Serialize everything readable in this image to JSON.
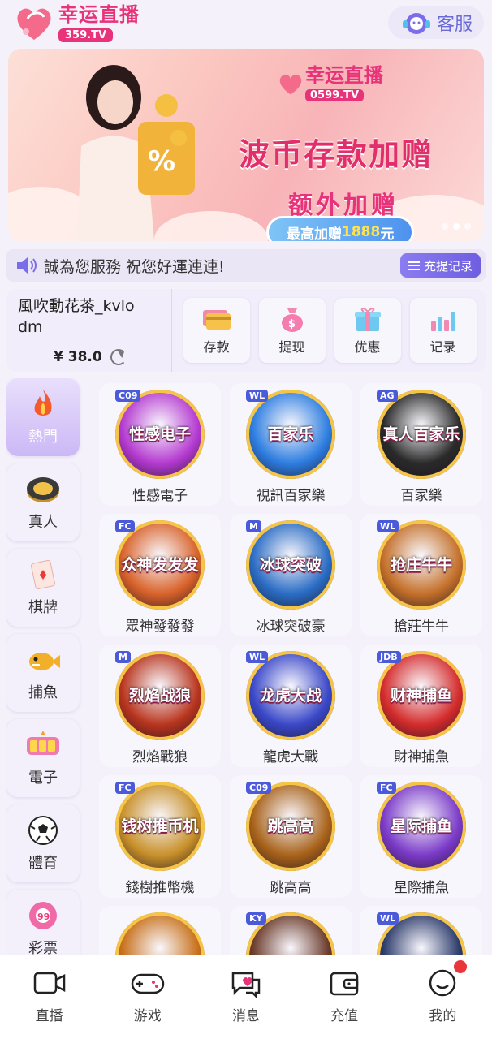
{
  "header": {
    "logo_title": "幸运直播",
    "logo_badge": "359.TV",
    "service_label": "客服"
  },
  "banner": {
    "brand_title": "幸运直播",
    "brand_badge": "0599.TV",
    "headline": "波币存款加赠",
    "subline": "额外加赠",
    "pill_prefix": "最高加赠",
    "pill_amount": "1888",
    "pill_suffix": "元",
    "slide_count": 3,
    "active_slide": 1
  },
  "notice": {
    "text": "誠為您服務 祝您好運連連!",
    "button_label": "充提记录"
  },
  "user": {
    "name": "風吹動花茶_kvlodm",
    "balance": "¥ 38.0"
  },
  "actions": [
    {
      "label": "存款",
      "icon": "card-icon"
    },
    {
      "label": "提现",
      "icon": "money-bag-icon"
    },
    {
      "label": "优惠",
      "icon": "gift-icon"
    },
    {
      "label": "记录",
      "icon": "bar-chart-icon"
    }
  ],
  "categories": [
    {
      "label": "熱門",
      "icon": "flame-icon",
      "active": true
    },
    {
      "label": "真人",
      "icon": "chip-icon",
      "active": false
    },
    {
      "label": "棋牌",
      "icon": "card-icon",
      "active": false
    },
    {
      "label": "捕魚",
      "icon": "fish-icon",
      "active": false
    },
    {
      "label": "電子",
      "icon": "slot-icon",
      "active": false
    },
    {
      "label": "體育",
      "icon": "soccer-ball-icon",
      "active": false
    },
    {
      "label": "彩票",
      "icon": "lottery-ball-icon",
      "active": false
    }
  ],
  "games": [
    {
      "name": "性感電子",
      "thumb_text": "性感电子",
      "provider": "C09",
      "color": "#b43ad0"
    },
    {
      "name": "視訊百家樂",
      "thumb_text": "百家乐",
      "provider": "WL",
      "color": "#2d7de0"
    },
    {
      "name": "百家樂",
      "thumb_text": "真人百家乐",
      "provider": "AG",
      "color": "#2a2a2a"
    },
    {
      "name": "眾神發發發",
      "thumb_text": "众神发发发",
      "provider": "FC",
      "color": "#d8622a"
    },
    {
      "name": "冰球突破豪",
      "thumb_text": "冰球突破",
      "provider": "M",
      "color": "#2a6cc4"
    },
    {
      "name": "搶莊牛牛",
      "thumb_text": "抢庄牛牛",
      "provider": "WL",
      "color": "#c4702a"
    },
    {
      "name": "烈焰戰狼",
      "thumb_text": "烈焰战狼",
      "provider": "M",
      "color": "#b8351e"
    },
    {
      "name": "龍虎大戰",
      "thumb_text": "龙虎大战",
      "provider": "WL",
      "color": "#3a48c8"
    },
    {
      "name": "財神捕魚",
      "thumb_text": "财神捕鱼",
      "provider": "JDB",
      "color": "#d42c2c"
    },
    {
      "name": "錢樹推幣機",
      "thumb_text": "钱树推币机",
      "provider": "FC",
      "color": "#c8902a"
    },
    {
      "name": "跳高高",
      "thumb_text": "跳高高",
      "provider": "C09",
      "color": "#a8621a"
    },
    {
      "name": "星際捕魚",
      "thumb_text": "星际捕鱼",
      "provider": "FC",
      "color": "#7a3ac8"
    },
    {
      "name": "",
      "thumb_text": "",
      "provider": "",
      "color": "#c8701a"
    },
    {
      "name": "",
      "thumb_text": "",
      "provider": "KY",
      "color": "#6a3a2a"
    },
    {
      "name": "",
      "thumb_text": "",
      "provider": "WL",
      "color": "#2a3a6a"
    }
  ],
  "nav": [
    {
      "label": "直播",
      "icon": "camera-icon"
    },
    {
      "label": "游戏",
      "icon": "gamepad-icon"
    },
    {
      "label": "消息",
      "icon": "chat-icon"
    },
    {
      "label": "充值",
      "icon": "wallet-icon"
    },
    {
      "label": "我的",
      "icon": "profile-icon",
      "badge": true
    }
  ],
  "colors": {
    "brand": "#e8327a",
    "accent": "#6d5fe0",
    "badge": "#e8363a"
  }
}
